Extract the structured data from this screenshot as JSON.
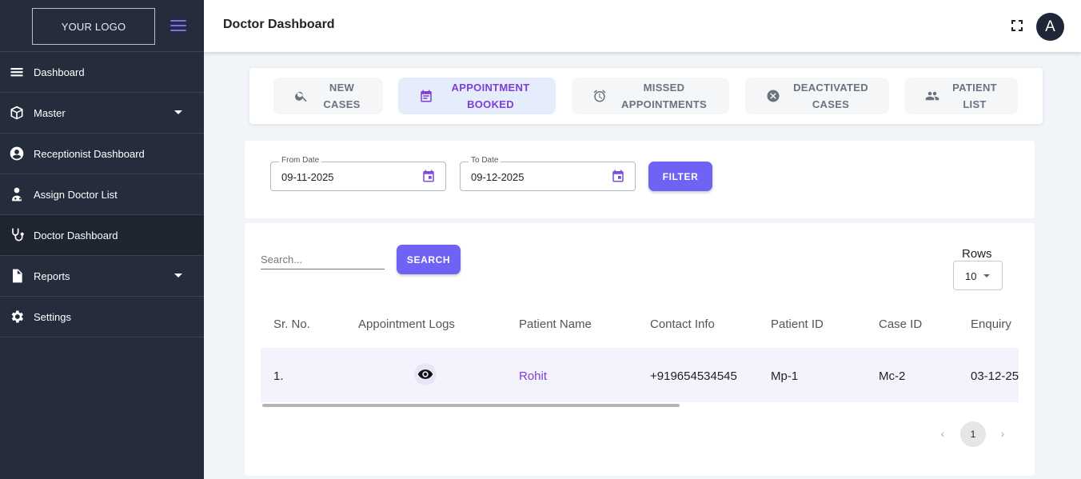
{
  "sidebar": {
    "logo": "YOUR LOGO",
    "items": [
      {
        "label": "Dashboard",
        "icon": "menu-icon"
      },
      {
        "label": "Master",
        "icon": "cube-icon",
        "has_caret": true
      },
      {
        "label": "Receptionist Dashboard",
        "icon": "account-circle-icon"
      },
      {
        "label": "Assign Doctor List",
        "icon": "doctor-icon"
      },
      {
        "label": "Doctor Dashboard",
        "icon": "stethoscope-icon",
        "active": true
      },
      {
        "label": "Reports",
        "icon": "document-icon",
        "has_caret": true
      },
      {
        "label": "Settings",
        "icon": "gear-icon"
      }
    ]
  },
  "header": {
    "title": "Doctor Dashboard",
    "avatar": "A"
  },
  "tabs": [
    {
      "line1": "NEW",
      "line2": "CASES",
      "icon": "search-icon"
    },
    {
      "line1": "APPOINTMENT",
      "line2": "BOOKED",
      "icon": "calendar-icon",
      "active": true
    },
    {
      "line1": "MISSED",
      "line2": "APPOINTMENTS",
      "icon": "alarm-icon"
    },
    {
      "line1": "DEACTIVATED",
      "line2": "CASES",
      "icon": "cancel-circle-icon"
    },
    {
      "line1": "PATIENT",
      "line2": "LIST",
      "icon": "people-icon"
    }
  ],
  "filter": {
    "from_label": "From Date",
    "from_value": "09-11-2025",
    "to_label": "To Date",
    "to_value": "09-12-2025",
    "button": "FILTER"
  },
  "table": {
    "search_placeholder": "Search...",
    "search_button": "SEARCH",
    "rows_label": "Rows",
    "rows_value": "10",
    "columns": [
      "Sr. No.",
      "Appointment Logs",
      "Patient Name",
      "Contact Info",
      "Patient ID",
      "Case ID",
      "Enquiry"
    ],
    "rows": [
      {
        "sr": "1.",
        "patient_name": "Rohit",
        "contact": "+919654534545",
        "patient_id": "Mp-1",
        "case_id": "Mc-2",
        "enquiry": "03-12-25"
      }
    ],
    "pagination": {
      "current": "1",
      "prev": "‹",
      "next": "›"
    }
  },
  "colors": {
    "sidebar_bg": "#252d3d",
    "accent": "#6f63f5",
    "active_tab_text": "#7e3fd6"
  }
}
